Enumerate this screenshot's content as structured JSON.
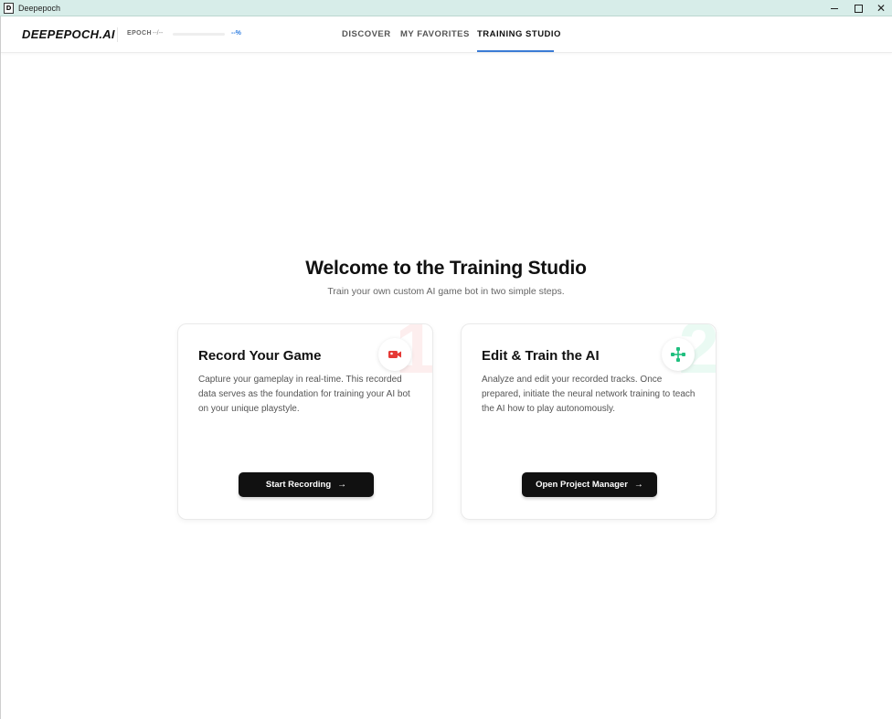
{
  "window": {
    "title": "Deepepoch",
    "app_icon_letter": "D"
  },
  "header": {
    "logo": "DEEPEPOCH.AI",
    "epoch_label": "EPOCH",
    "epoch_value": "--/--",
    "progress_percent_text": "--%",
    "progress_fraction": 0,
    "accent_color": "#3a7bd5"
  },
  "nav": {
    "items": [
      {
        "label": "DISCOVER",
        "active": false
      },
      {
        "label": "MY FAVORITES",
        "active": false
      },
      {
        "label": "TRAINING STUDIO",
        "active": true
      }
    ]
  },
  "hero": {
    "title": "Welcome to the Training Studio",
    "subtitle": "Train your own custom AI game bot in two simple steps."
  },
  "cards": [
    {
      "step": "1",
      "icon": "video-camera-icon",
      "icon_color": "#e53935",
      "title": "Record Your Game",
      "description": "Capture your gameplay in real-time. This recorded data serves as the foundation for training your AI bot on your unique playstyle.",
      "button_label": "Start Recording",
      "button_arrow": "→"
    },
    {
      "step": "2",
      "icon": "network-nodes-icon",
      "icon_color": "#1fbf7f",
      "title": "Edit & Train the AI",
      "description": "Analyze and edit your recorded tracks. Once prepared, initiate the neural network training to teach the AI how to play autonomously.",
      "button_label": "Open Project Manager",
      "button_arrow": "→"
    }
  ]
}
